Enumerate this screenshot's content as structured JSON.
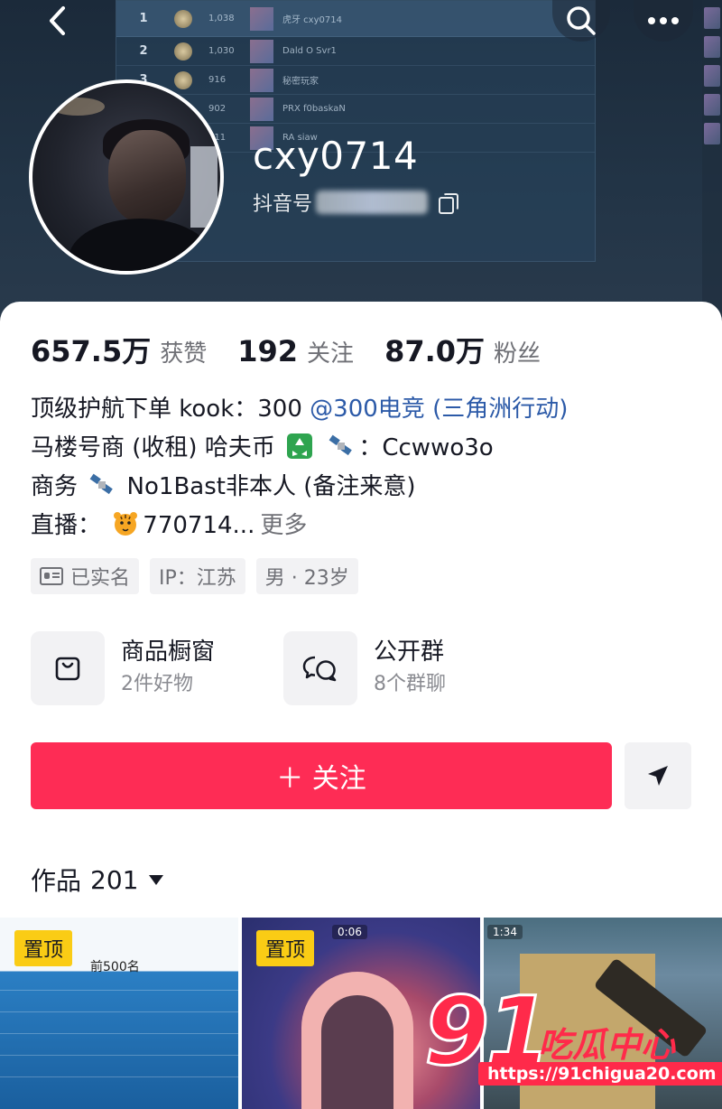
{
  "header": {
    "leaderboard": [
      {
        "rank": "1",
        "points": "1,038",
        "name": "虎牙 cxy0714"
      },
      {
        "rank": "2",
        "points": "1,030",
        "name": "Dald O Svr1"
      },
      {
        "rank": "3",
        "points": "916",
        "name": "秘密玩家"
      },
      {
        "rank": "",
        "points": "902",
        "name": "PRX f0baskaN"
      },
      {
        "rank": "",
        "points": "911",
        "name": "RA siaw"
      }
    ]
  },
  "profile": {
    "username": "cxy0714",
    "id_label": "抖音号"
  },
  "stats": [
    {
      "value": "657.5万",
      "label": "获赞"
    },
    {
      "value": "192",
      "label": "关注"
    },
    {
      "value": "87.0万",
      "label": "粉丝"
    }
  ],
  "bio": {
    "line1_text": "顶级护航下单 kook：300 ",
    "line1_mention": "@300电竞 (三角洲行动)",
    "line2_text": "马楼号商 (收租) 哈夫币",
    "line2_suffix": "：Ccwwo3o",
    "line3_prefix": "商务",
    "line3_text": " No1Bast非本人 (备注来意)",
    "line4_prefix": "直播：",
    "line4_text": "770714...",
    "more": "更多"
  },
  "tags": {
    "verified": "已实名",
    "ip": "IP：江苏",
    "gender_age": "男 · 23岁"
  },
  "entries": {
    "shop_title": "商品橱窗",
    "shop_sub": "2件好物",
    "group_title": "公开群",
    "group_sub": "8个群聊"
  },
  "actions": {
    "follow": "＋ 关注"
  },
  "works": {
    "label": "作品",
    "count": "201"
  },
  "thumbnails": {
    "pinned": "置顶",
    "thumb1_title": "前500名",
    "thumb2_timer": "0:06",
    "thumb3_timer": "1:34"
  },
  "watermark": {
    "number": "91",
    "name": "吃瓜中心",
    "url": "https://91chigua20.com"
  },
  "colors": {
    "accent": "#fe2c55",
    "mention": "#2c5aa8",
    "pin_badge": "#facc15"
  }
}
